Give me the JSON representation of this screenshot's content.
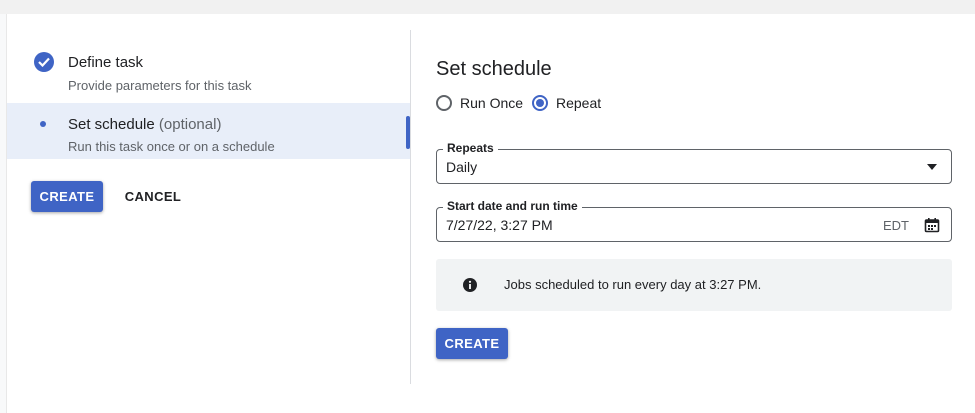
{
  "stepper": {
    "steps": [
      {
        "title": "Define task",
        "subtitle": "Provide parameters for this task",
        "status": "complete"
      },
      {
        "title": "Set schedule",
        "optional": "(optional)",
        "subtitle": "Run this task once or on a schedule",
        "status": "active"
      }
    ],
    "create_label": "CREATE",
    "cancel_label": "CANCEL"
  },
  "schedule": {
    "title": "Set schedule",
    "frequency_options": [
      {
        "label": "Run Once",
        "selected": false
      },
      {
        "label": "Repeat",
        "selected": true
      }
    ],
    "repeats": {
      "label": "Repeats",
      "value": "Daily"
    },
    "start": {
      "label": "Start date and run time",
      "value": "7/27/22, 3:27 PM",
      "timezone": "EDT"
    },
    "info_message": "Jobs scheduled to run every day at 3:27 PM.",
    "create_label": "CREATE"
  },
  "colors": {
    "accent": "#3f64c5",
    "active_step_bg": "#e8eef9",
    "info_bg": "#f1f3f4"
  },
  "icons": {
    "complete": "check-icon",
    "calendar": "calendar-icon",
    "info": "info-icon",
    "dropdown": "dropdown-arrow-icon"
  }
}
